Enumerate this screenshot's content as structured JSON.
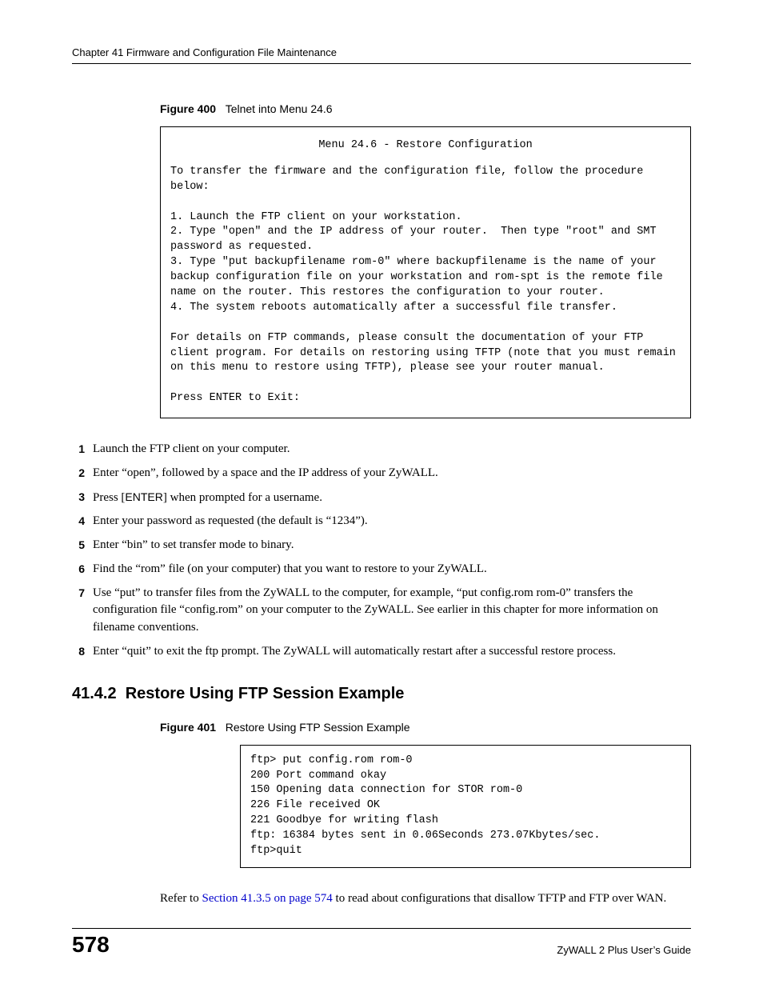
{
  "header": {
    "running": "Chapter 41 Firmware and Configuration File Maintenance"
  },
  "figure400": {
    "label": "Figure 400",
    "caption": "Telnet into Menu 24.6",
    "title_line": "Menu 24.6 - Restore Configuration",
    "body": "To transfer the firmware and the configuration file, follow the procedure below:\n\n1. Launch the FTP client on your workstation.\n2. Type \"open\" and the IP address of your router.  Then type \"root\" and SMT password as requested.\n3. Type \"put backupfilename rom-0\" where backupfilename is the name of your backup configuration file on your workstation and rom-spt is the remote file name on the router. This restores the configuration to your router.\n4. The system reboots automatically after a successful file transfer.\n\nFor details on FTP commands, please consult the documentation of your FTP client program. For details on restoring using TFTP (note that you must remain on this menu to restore using TFTP), please see your router manual.\n\nPress ENTER to Exit:"
  },
  "steps": [
    {
      "num": "1",
      "text": "Launch the FTP client on your computer."
    },
    {
      "num": "2",
      "text": "Enter “open”, followed by a space and the IP address of your ZyWALL."
    },
    {
      "num": "3",
      "prefix": "Press [",
      "key": "ENTER",
      "suffix": "] when prompted for a username."
    },
    {
      "num": "4",
      "text": "Enter your password as requested (the default is “1234”)."
    },
    {
      "num": "5",
      "text": "Enter “bin” to set transfer mode to binary."
    },
    {
      "num": "6",
      "text": "Find the “rom” file (on your computer) that you want to restore to your ZyWALL."
    },
    {
      "num": "7",
      "text": "Use “put” to transfer files from the ZyWALL to the computer, for example, “put config.rom rom-0” transfers the configuration file “config.rom” on your computer to the ZyWALL. See earlier in this chapter for more information on filename conventions."
    },
    {
      "num": "8",
      "text": "Enter “quit” to exit the ftp prompt. The ZyWALL will automatically restart after a successful restore process."
    }
  ],
  "section": {
    "number": "41.4.2",
    "title": "Restore Using FTP Session Example"
  },
  "figure401": {
    "label": "Figure 401",
    "caption": "Restore Using FTP Session Example",
    "body": "ftp> put config.rom rom-0\n200 Port command okay\n150 Opening data connection for STOR rom-0\n226 File received OK\n221 Goodbye for writing flash\nftp: 16384 bytes sent in 0.06Seconds 273.07Kbytes/sec.\nftp>quit"
  },
  "closing": {
    "prefix": "Refer to ",
    "xref": "Section 41.3.5 on page 574",
    "suffix": " to read about configurations that disallow TFTP and FTP over WAN."
  },
  "footer": {
    "page": "578",
    "guide": "ZyWALL 2 Plus User’s Guide"
  }
}
